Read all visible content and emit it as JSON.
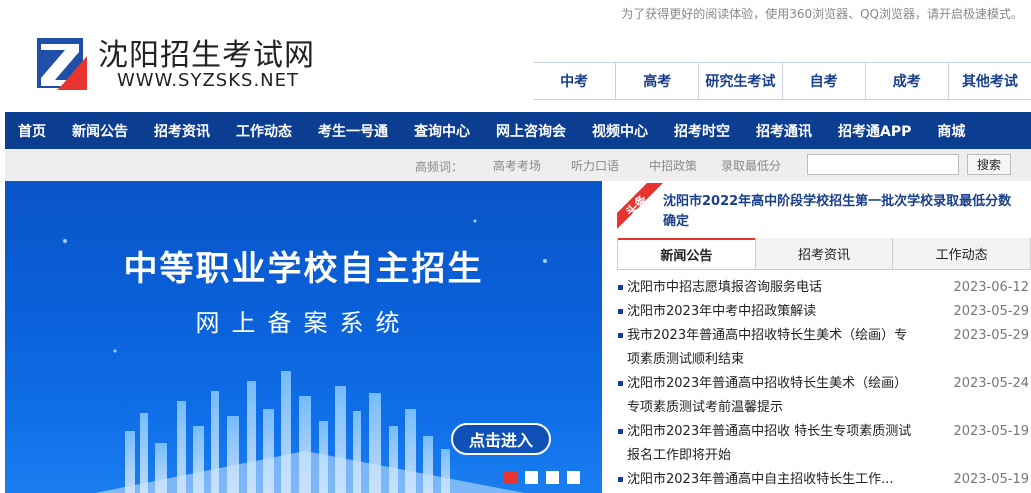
{
  "top_tip": "为了获得更好的阅读体验，使用360浏览器、QQ浏览器，请开启极速模式。",
  "site": {
    "name": "沈阳招生考试网",
    "url": "WWW.SYZSKS.NET"
  },
  "exam_tabs": [
    "中考",
    "高考",
    "研究生考试",
    "自考",
    "成考",
    "其他考试"
  ],
  "nav": [
    "首页",
    "新闻公告",
    "招考资讯",
    "工作动态",
    "考生一号通",
    "查询中心",
    "网上咨询会",
    "视频中心",
    "招考时空",
    "招考通讯",
    "招考通APP",
    "商城"
  ],
  "hot": {
    "label": "高频词：",
    "words": [
      "高考考场",
      "听力口语",
      "中招政策",
      "录取最低分"
    ],
    "search_placeholder": "",
    "search_button": "搜索"
  },
  "banner": {
    "title": "中等职业学校自主招生",
    "subtitle": "网上备案系统",
    "button": "点击进入",
    "slide_count": 4,
    "active_slide": 0
  },
  "headline": {
    "badge": "头条",
    "title": "沈阳市2022年高中阶段学校招生第一批次学校录取最低分数确定"
  },
  "news_tabs": [
    "新闻公告",
    "招考资讯",
    "工作动态"
  ],
  "news": [
    {
      "title": "沈阳市中招志愿填报咨询服务电话",
      "date": "2023-06-12"
    },
    {
      "title": "沈阳市2023年中考中招政策解读",
      "date": "2023-05-29"
    },
    {
      "title": "我市2023年普通高中招收特长生美术（绘画）专项素质测试顺利结束",
      "date": "2023-05-29"
    },
    {
      "title": "沈阳市2023年普通高中招收特长生美术（绘画）专项素质测试考前温馨提示",
      "date": "2023-05-24"
    },
    {
      "title": "沈阳市2023年普通高中招收 特长生专项素质测试报名工作即将开始",
      "date": "2023-05-19"
    },
    {
      "title": "沈阳市2023年普通高中自主招收特长生工作...",
      "date": "2023-05-19"
    }
  ],
  "colors": {
    "nav_bg": "#0b3d91",
    "accent_red": "#e8342f",
    "link_blue": "#1a3f8a"
  }
}
